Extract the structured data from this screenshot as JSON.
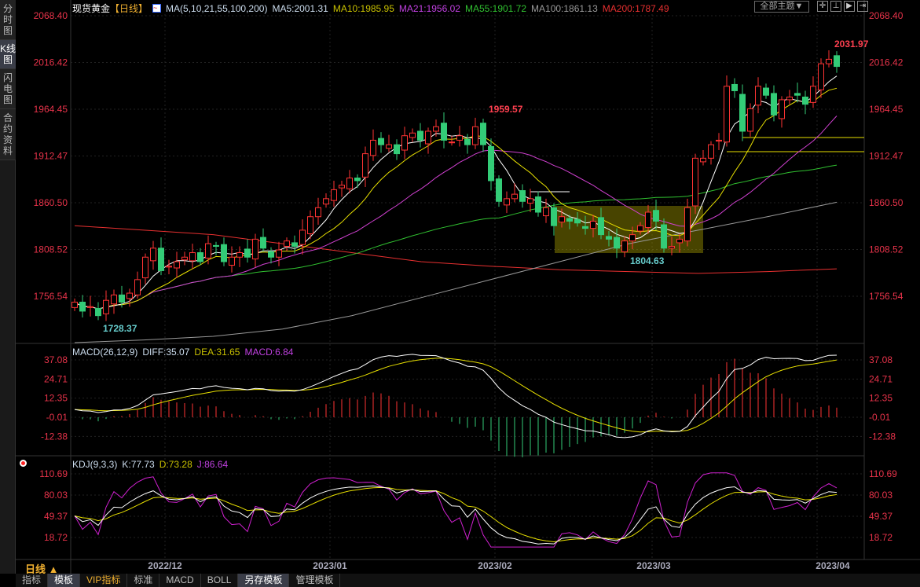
{
  "sidebar": {
    "items": [
      {
        "label": "分时图"
      },
      {
        "label": "K线图",
        "active": true
      },
      {
        "label": "闪电图"
      },
      {
        "label": "合约资料"
      }
    ]
  },
  "header": {
    "symbol": "现货黄金",
    "period": "【日线】",
    "ma_label": "MA(5,10,21,55,100,200)",
    "ma5": "MA5:2001.31",
    "ma10": "MA10:1985.95",
    "ma21": "MA21:1956.02",
    "ma55": "MA55:1901.72",
    "ma100": "MA100:1861.13",
    "ma200": "MA200:1787.49",
    "theme_button": "全部主题▼"
  },
  "colors": {
    "up": "#ff3333",
    "down": "#33cc77",
    "ma5": "#ffffff",
    "ma10": "#e8e000",
    "ma21": "#d040d0",
    "ma55": "#30c030",
    "ma100": "#999999",
    "ma200": "#e83030",
    "axis_text": "#e8334a"
  },
  "price_axis": {
    "ticks": [
      "2068.40",
      "2016.42",
      "1964.45",
      "1912.47",
      "1860.50",
      "1808.52",
      "1756.54"
    ]
  },
  "annotations": {
    "high": "1959.57",
    "low": "1804.63",
    "low0": "1728.37",
    "last_high": "2031.97"
  },
  "macd": {
    "label": "MACD(26,12,9)",
    "diff": "DIFF:35.07",
    "dea": "DEA:31.65",
    "macd": "MACD:6.84",
    "ticks": [
      "37.08",
      "24.71",
      "12.35",
      "-0.01",
      "-12.38"
    ]
  },
  "kdj": {
    "label": "KDJ(9,3,3)",
    "k": "K:77.73",
    "d": "D:73.28",
    "j": "J:86.64",
    "ticks": [
      "110.69",
      "80.03",
      "49.37",
      "18.72"
    ]
  },
  "dates": [
    "2022/12",
    "2023/01",
    "2023/02",
    "2023/03",
    "2023/04"
  ],
  "period_label": "日线 ▲",
  "tabs": [
    {
      "label": "指标"
    },
    {
      "label": "模板",
      "on": true
    },
    {
      "label": "VIP指标",
      "vip": true
    },
    {
      "label": "标准"
    },
    {
      "label": "MACD"
    },
    {
      "label": "BOLL"
    },
    {
      "label": "另存模板",
      "on": true
    },
    {
      "label": "管理模板"
    }
  ],
  "chart_data": {
    "type": "candlestick",
    "price_range": [
      1756.54,
      2068.4
    ],
    "closes": [
      1750,
      1740,
      1745,
      1735,
      1752,
      1758,
      1750,
      1760,
      1775,
      1800,
      1810,
      1785,
      1790,
      1795,
      1800,
      1805,
      1795,
      1815,
      1812,
      1795,
      1800,
      1805,
      1800,
      1820,
      1810,
      1800,
      1808,
      1818,
      1812,
      1830,
      1845,
      1855,
      1865,
      1875,
      1880,
      1888,
      1885,
      1915,
      1930,
      1925,
      1925,
      1915,
      1935,
      1938,
      1930,
      1940,
      1945,
      1930,
      1928,
      1935,
      1925,
      1945,
      1925,
      1885,
      1862,
      1865,
      1870,
      1862,
      1865,
      1850,
      1855,
      1835,
      1845,
      1840,
      1838,
      1832,
      1840,
      1825,
      1820,
      1810,
      1818,
      1825,
      1835,
      1850,
      1840,
      1810,
      1812,
      1820,
      1855,
      1910,
      1910,
      1925,
      1930,
      1990,
      1985,
      1940,
      1965,
      1990,
      1980,
      1958,
      1975,
      1978,
      1980,
      1970,
      1990,
      2015,
      2020,
      2012
    ],
    "ma100": [
      1705,
      1708,
      1712,
      1720,
      1735,
      1755,
      1775,
      1795,
      1815,
      1830,
      1845,
      1861
    ],
    "ma200": [
      1835,
      1830,
      1825,
      1815,
      1805,
      1795,
      1790,
      1786,
      1784,
      1782,
      1784,
      1787
    ]
  }
}
